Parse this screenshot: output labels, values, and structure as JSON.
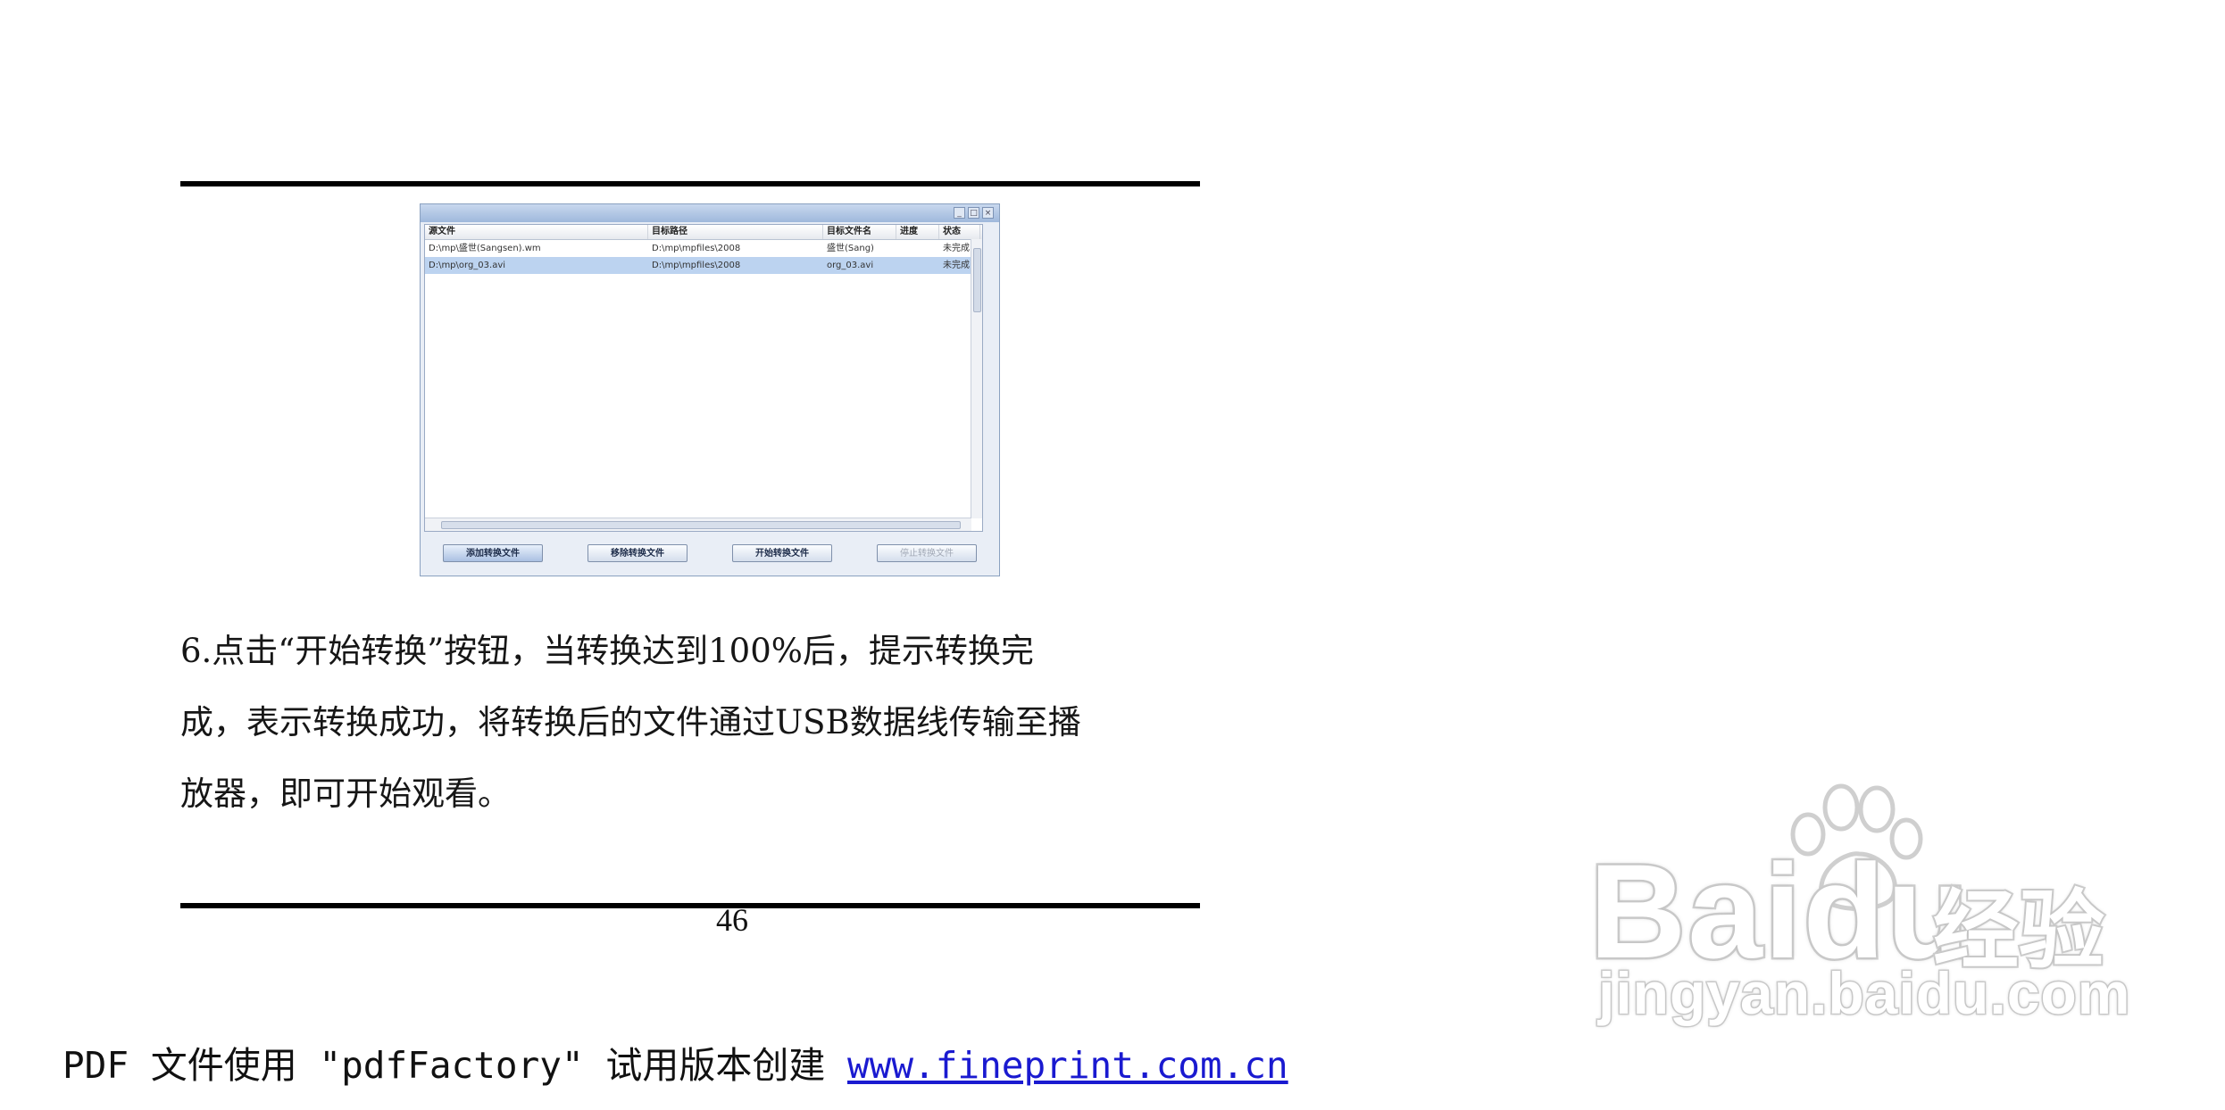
{
  "embedded_app": {
    "title": "",
    "window_controls": [
      "_",
      "□",
      "×"
    ],
    "columns": [
      "源文件",
      "目标路径",
      "目标文件名",
      "进度",
      "状态"
    ],
    "rows": [
      {
        "source": "D:\\mp\\盛世(Sangsen).wm",
        "target_path": "D:\\mp\\mpfiles\\2008",
        "target_name": "盛世(Sang)",
        "progress": "",
        "status": "未完成",
        "selected": false
      },
      {
        "source": "D:\\mp\\org_03.avi",
        "target_path": "D:\\mp\\mpfiles\\2008",
        "target_name": "org_03.avi",
        "progress": "",
        "status": "未完成",
        "selected": true
      }
    ],
    "buttons": {
      "add": "添加转换文件",
      "remove": "移除转换文件",
      "start": "开始转换文件",
      "stop": "停止转换文件"
    }
  },
  "paragraph": {
    "line1": "6.点击“开始转换”按钮，当转换达到100%后，提示转换完",
    "line2": "成，表示转换成功，将转换后的文件通过USB数据线传输至播",
    "line3": "放器，即可开始观看。"
  },
  "page_number": "46",
  "footer": {
    "prefix": "PDF 文件使用 \"pdfFactory\" 试用版本创建 ",
    "link": "www.fineprint.com.cn"
  },
  "watermark": {
    "brand": "Baidu",
    "suffix": "经验",
    "domain": "jingyan.baidu.com"
  }
}
